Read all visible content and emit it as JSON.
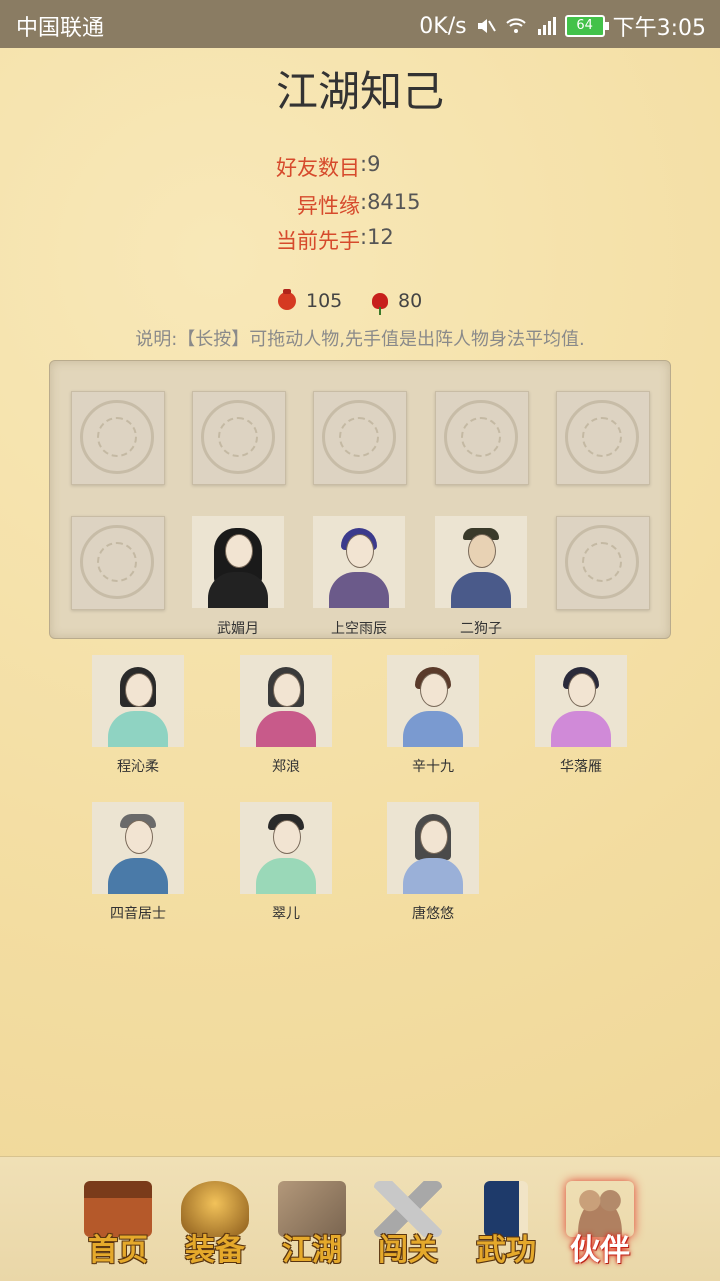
{
  "status_bar": {
    "carrier": "中国联通",
    "speed": "0K/s",
    "battery": "64",
    "time": "下午3:05"
  },
  "page": {
    "title": "江湖知己"
  },
  "stats": {
    "friends_label": "好友数目",
    "friends_value": ":9",
    "affinity_label": "异性缘",
    "affinity_value": ":8415",
    "initiative_label": "当前先手",
    "initiative_value": ":12"
  },
  "currency": {
    "bag_value": "105",
    "rose_value": "80",
    "bag_icon": "red-pouch-icon",
    "rose_icon": "rose-icon"
  },
  "note": "说明:【长按】可拖动人物,先手值是出阵人物身法平均值.",
  "formation": {
    "deployed": [
      {
        "name": "武媚月",
        "hair": "#1a1a1a",
        "robe": "#222222"
      },
      {
        "name": "上空雨辰",
        "hair": "#3b3a8c",
        "robe": "#6b5a8a"
      },
      {
        "name": "二狗子",
        "hair": "#3a3a2a",
        "robe": "#4a5a8a"
      }
    ]
  },
  "companions": [
    {
      "name": "程沁柔",
      "hair": "#2a2a2a",
      "robe": "#8fd3c2"
    },
    {
      "name": "郑浪",
      "hair": "#3a3a3a",
      "robe": "#c85a8a"
    },
    {
      "name": "辛十九",
      "hair": "#5a3a2a",
      "robe": "#7a9ad0"
    },
    {
      "name": "华落雁",
      "hair": "#2a2a3a",
      "robe": "#d08ad8"
    },
    {
      "name": "四音居士",
      "hair": "#6a6a6a",
      "robe": "#4a7aa8"
    },
    {
      "name": "翠儿",
      "hair": "#2a2a2a",
      "robe": "#9ad8b8"
    },
    {
      "name": "唐悠悠",
      "hair": "#4a4a4a",
      "robe": "#9ab0d8"
    }
  ],
  "nav": {
    "home": "首页",
    "equipment": "装备",
    "jianghu": "江湖",
    "trials": "闯关",
    "martial": "武功",
    "partners": "伙伴"
  },
  "colors": {
    "accent_label": "#d64a2c",
    "background": "#f5e2a9",
    "nav_label": "#e5a92b"
  }
}
